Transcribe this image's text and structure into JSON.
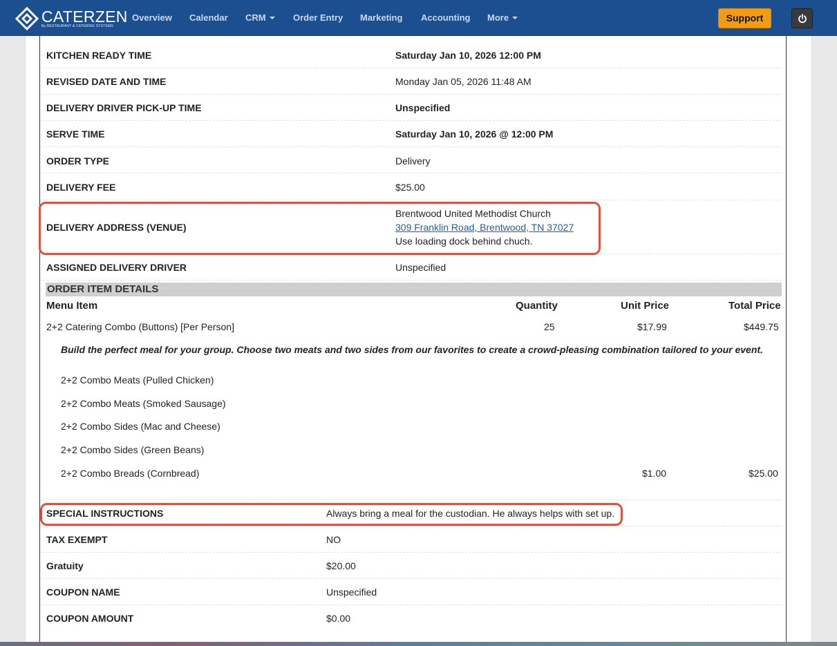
{
  "brand": {
    "name": "CATERZEN",
    "tagline": "By RESTAURANT & CATERING SYSTEMS"
  },
  "nav": {
    "items": [
      {
        "label": "Overview"
      },
      {
        "label": "Calendar"
      },
      {
        "label": "CRM"
      },
      {
        "label": "Order Entry"
      },
      {
        "label": "Marketing"
      },
      {
        "label": "Accounting"
      },
      {
        "label": "More"
      }
    ],
    "support_label": "Support"
  },
  "order_details": [
    {
      "label": "KITCHEN READY TIME",
      "value": "Saturday Jan 10, 2026 12:00 PM"
    },
    {
      "label": "REVISED DATE AND TIME",
      "value": "Monday Jan 05, 2026 11:48 AM"
    },
    {
      "label": "DELIVERY DRIVER PICK-UP TIME",
      "value": "Unspecified"
    },
    {
      "label": "SERVE TIME",
      "value": "Saturday Jan 10, 2026 @ 12:00 PM"
    },
    {
      "label": "ORDER TYPE",
      "value": "Delivery"
    },
    {
      "label": "DELIVERY FEE",
      "value": "$25.00"
    }
  ],
  "delivery_address": {
    "label": "DELIVERY ADDRESS (VENUE)",
    "venue": "Brentwood United Methodist Church",
    "address_link": "309 Franklin Road, Brentwood, TN 37027",
    "note": "Use loading dock behind chuch."
  },
  "assigned_driver": {
    "label": "ASSIGNED DELIVERY DRIVER",
    "value": "Unspecified"
  },
  "items_section": {
    "title": "ORDER ITEM DETAILS",
    "columns": {
      "menu_item": "Menu Item",
      "quantity": "Quantity",
      "unit_price": "Unit Price",
      "total_price": "Total Price"
    },
    "main_item": {
      "name": "2+2 Catering Combo (Buttons) [Per Person]",
      "quantity": "25",
      "unit_price": "$17.99",
      "total_price": "$449.75"
    },
    "description": "Build the perfect meal for your group. Choose two meats and two sides from our favorites to create a crowd-pleasing combination tailored to your event.",
    "sub_items": [
      {
        "name": "2+2 Combo Meats (Pulled Chicken)",
        "unit_price": "",
        "total_price": ""
      },
      {
        "name": "2+2 Combo Meats (Smoked Sausage)",
        "unit_price": "",
        "total_price": ""
      },
      {
        "name": "2+2 Combo Sides (Mac and Cheese)",
        "unit_price": "",
        "total_price": ""
      },
      {
        "name": "2+2 Combo Sides (Green Beans)",
        "unit_price": "",
        "total_price": ""
      },
      {
        "name": "2+2 Combo Breads (Cornbread)",
        "unit_price": "$1.00",
        "total_price": "$25.00"
      }
    ]
  },
  "summary": [
    {
      "label": "SPECIAL INSTRUCTIONS",
      "value": "Always bring a meal for the custodian. He always helps with set up."
    },
    {
      "label": "TAX EXEMPT",
      "value": "NO"
    },
    {
      "label": "Gratuity",
      "value": "$20.00"
    },
    {
      "label": "COUPON NAME",
      "value": "Unspecified"
    },
    {
      "label": "COUPON AMOUNT",
      "value": "$0.00"
    }
  ],
  "colors": {
    "navbar": "#1c4f8f",
    "support": "#f39c12",
    "highlight": "#d9533f",
    "link": "#1a5fa8"
  }
}
